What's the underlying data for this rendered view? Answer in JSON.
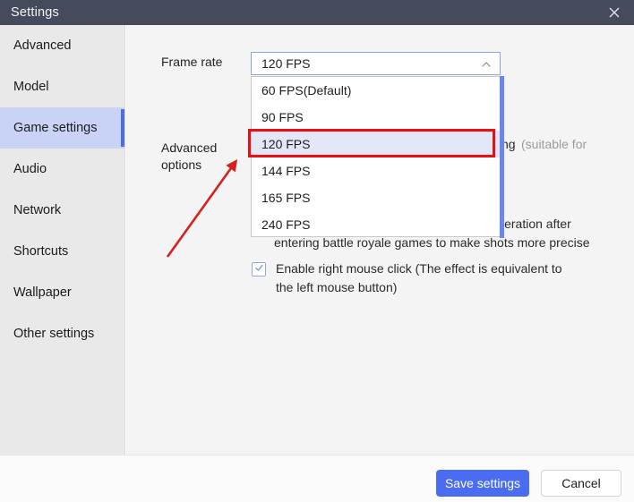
{
  "window": {
    "title": "Settings",
    "close_icon": "close-icon"
  },
  "sidebar": {
    "items": [
      {
        "label": "Advanced",
        "active": false
      },
      {
        "label": "Model",
        "active": false
      },
      {
        "label": "Game settings",
        "active": true
      },
      {
        "label": "Audio",
        "active": false
      },
      {
        "label": "Network",
        "active": false
      },
      {
        "label": "Shortcuts",
        "active": false
      },
      {
        "label": "Wallpaper",
        "active": false
      },
      {
        "label": "Other settings",
        "active": false
      }
    ]
  },
  "main": {
    "frame_rate_label": "Frame rate",
    "advanced_options_label": "Advanced options",
    "frame_rate": {
      "value": "120 FPS",
      "expanded": true,
      "chevron_icon": "chevron-up-icon",
      "options": [
        {
          "label": "60  FPS(Default)",
          "selected": false
        },
        {
          "label": "90 FPS",
          "selected": false
        },
        {
          "label": "120 FPS",
          "selected": true
        },
        {
          "label": "144 FPS",
          "selected": false
        },
        {
          "label": "165 FPS",
          "selected": false
        },
        {
          "label": "240 FPS",
          "selected": false
        }
      ]
    },
    "description_occluded": {
      "line1_tail": "ng",
      "line1_dim_tail": "(suitable for",
      "line2_tail": "leration after",
      "line3": "entering battle royale games to make shots more precise"
    },
    "right_click_checkbox": {
      "checked": true,
      "check_icon": "check-icon",
      "label": "Enable right mouse click (The effect is equivalent to the left mouse button)"
    }
  },
  "annotations": {
    "highlight_rect_target": "120 FPS",
    "arrow_points_to": "Advanced options frame rate dropdown",
    "color": "#ec0e11"
  },
  "footer": {
    "save_label": "Save settings",
    "cancel_label": "Cancel",
    "save_color": "#4a6cf0"
  }
}
